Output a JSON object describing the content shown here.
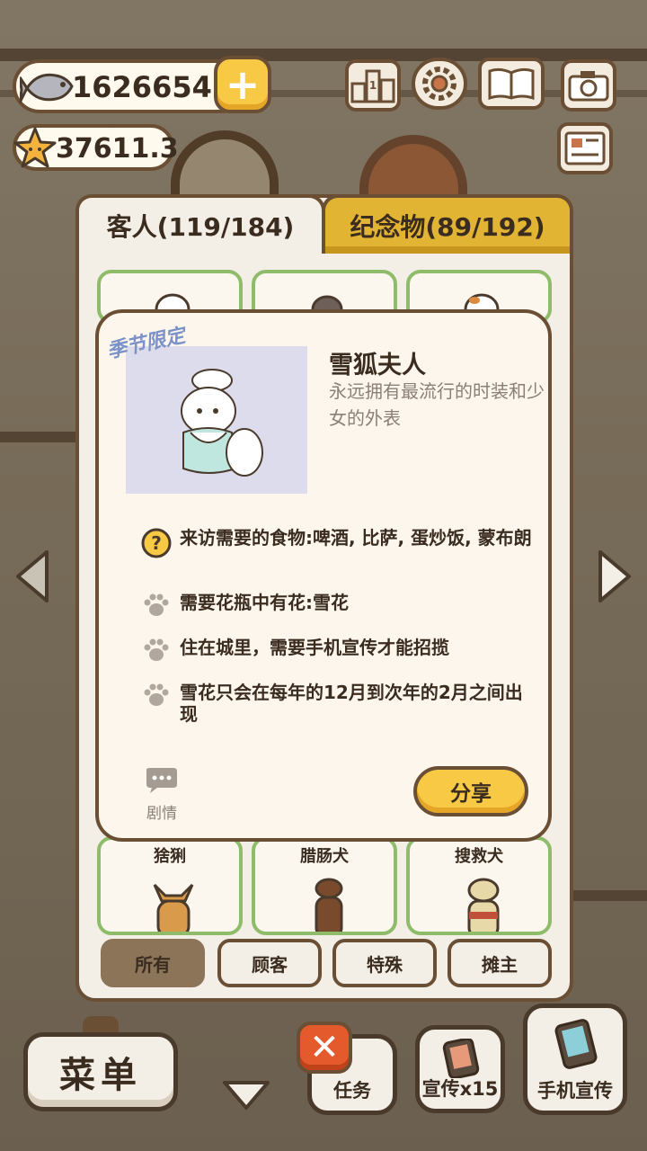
{
  "hud": {
    "fish_count": "1626654",
    "star_count": "37611.3",
    "plus_label": "+",
    "ranking_icon": "ranking-icon",
    "settings_icon": "gear-icon",
    "recipe_icon": "book-icon",
    "camera_icon": "camera-icon",
    "news_icon": "newspaper-icon"
  },
  "tabs": {
    "guests": "客人(119/184)",
    "souvenirs": "纪念物(89/192)"
  },
  "dialog": {
    "season_tag": "季节限定",
    "guest_name": "雪狐夫人",
    "guest_desc": "永远拥有最流行的时装和少女的外表",
    "requirements": [
      {
        "icon": "question-icon",
        "text": "来访需要的食物:啤酒, 比萨, 蛋炒饭, 蒙布朗"
      },
      {
        "icon": "paw-icon",
        "text": "需要花瓶中有花:雪花"
      },
      {
        "icon": "paw-icon",
        "text": "住在城里，需要手机宣传才能招揽"
      },
      {
        "icon": "paw-icon",
        "text": "雪花只会在每年的12月到次年的2月之间出现"
      }
    ],
    "story_label": "剧情",
    "share_label": "分享"
  },
  "grid": {
    "bottom_cards": [
      "猞猁",
      "腊肠犬",
      "搜救犬"
    ]
  },
  "filters": {
    "all": "所有",
    "customers": "顾客",
    "special": "特殊",
    "vendor": "摊主"
  },
  "bottom_bar": {
    "menu_label": "菜单",
    "tasks_label": "任务",
    "promo_x15_label": "宣传x15",
    "phone_promo_label": "手机宣传",
    "close_label": "✕"
  },
  "colors": {
    "accent_yellow": "#f7c945",
    "outline_brown": "#6b4f35",
    "card_green": "#8fbc6a",
    "panel_cream": "#f4efe6"
  }
}
